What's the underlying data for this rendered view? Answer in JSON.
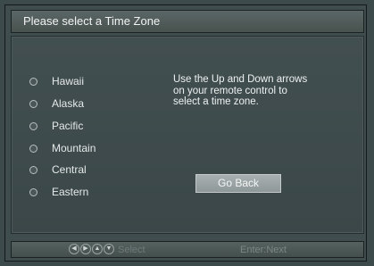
{
  "dialog": {
    "title": "Please select a Time Zone"
  },
  "time_zones": [
    {
      "label": "Hawaii"
    },
    {
      "label": "Alaska"
    },
    {
      "label": "Pacific"
    },
    {
      "label": "Mountain"
    },
    {
      "label": "Central"
    },
    {
      "label": "Eastern"
    }
  ],
  "instructions": {
    "lines": [
      "Use the Up and Down arrows",
      "on your remote control to",
      "select a time zone."
    ]
  },
  "buttons": {
    "go_back_label": "Go Back"
  },
  "footer": {
    "nav_icons": [
      "left-arrow-icon",
      "right-arrow-icon",
      "up-arrow-icon",
      "down-arrow-icon"
    ],
    "select_label": "Select",
    "enter_label": "Enter:Next"
  },
  "colors": {
    "background": "#3c4a4b",
    "text": "#e6e9e9",
    "button": "#9ea6a7"
  }
}
